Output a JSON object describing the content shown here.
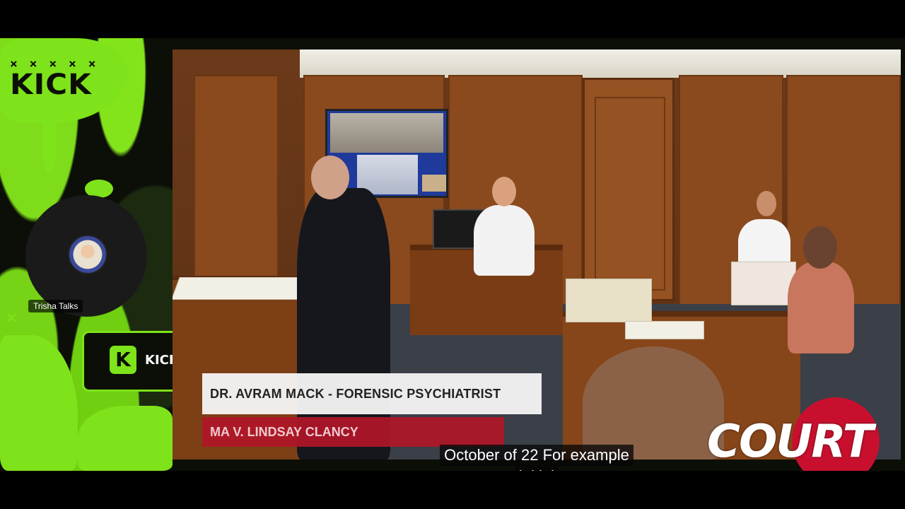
{
  "sidebar": {
    "kick_logo_marks": "× × × × ×",
    "kick_logo_text": "KICK",
    "streamer_name": "Trisha Talks",
    "kick_badge_letter": "K",
    "kick_badge_text": "KICK"
  },
  "broadcast": {
    "lower_third_name": "DR. AVRAM MACK - FORENSIC PSYCHIATRIST",
    "lower_third_case": "MA V. LINDSAY CLANCY",
    "caption_line_1": "October of 22 For example",
    "caption_line_2": "initial",
    "network_logo": "COURT TV"
  },
  "colors": {
    "brand_green": "#7ee31a",
    "lower_third_red": "#b01628",
    "court_tv_red": "#c8102e"
  }
}
